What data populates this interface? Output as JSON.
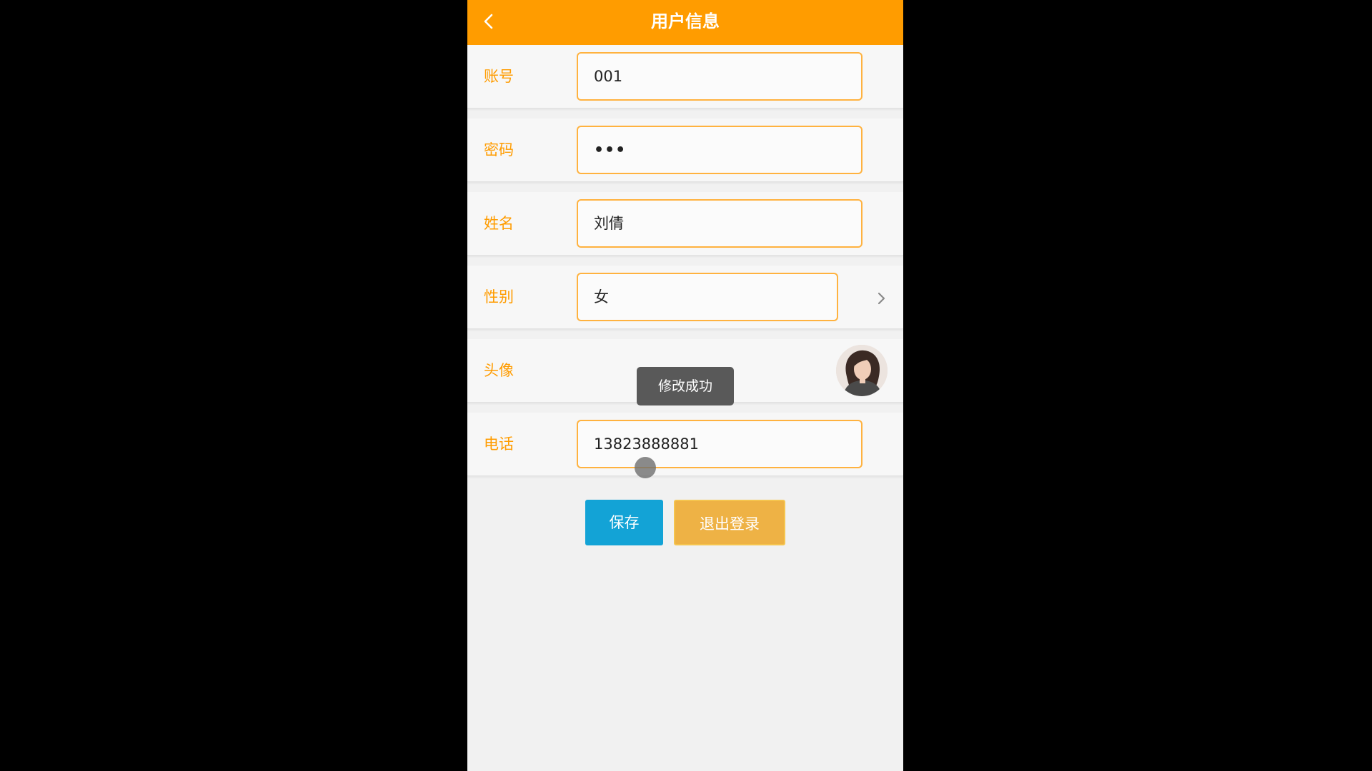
{
  "header": {
    "title": "用户信息"
  },
  "form": {
    "account": {
      "label": "账号",
      "value": "001"
    },
    "password": {
      "label": "密码",
      "value": "•••"
    },
    "name": {
      "label": "姓名",
      "value": "刘倩"
    },
    "gender": {
      "label": "性别",
      "value": "女"
    },
    "avatar": {
      "label": "头像"
    },
    "phone": {
      "label": "电话",
      "value": "13823888881"
    }
  },
  "toast": {
    "text": "修改成功"
  },
  "actions": {
    "save_label": "保存",
    "logout_label": "退出登录"
  },
  "icons": {
    "back": "chevron-left-icon",
    "gender_select": "chevron-right-icon"
  },
  "colors": {
    "accent": "#ff9c00",
    "save_button": "#13a3d6",
    "logout_button": "#eeb245",
    "page_background": "#f1f1f1"
  }
}
